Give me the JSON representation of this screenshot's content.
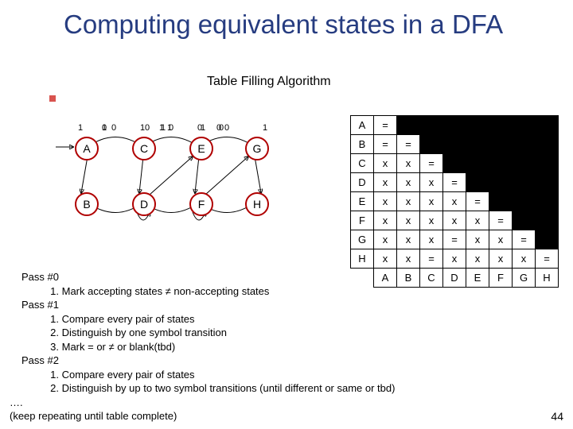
{
  "title": "Computing equivalent states in a DFA",
  "subtitle": "Table Filling Algorithm",
  "nodes": {
    "A": "A",
    "B": "B",
    "C": "C",
    "D": "D",
    "E": "E",
    "F": "F",
    "G": "G",
    "H": "H"
  },
  "edge_labels": {
    "AC0": "0",
    "AC1": "1",
    "AB0": "0",
    "AB1": "1",
    "CE1": "1",
    "CD0": "0",
    "BD1": "1",
    "DF1": "1",
    "DE0": "0",
    "EG0": "0",
    "EF1": "1",
    "FG0": "0",
    "GH1": "1",
    "FH0": "0",
    "D1": "1",
    "F0": "0"
  },
  "table": {
    "rows": [
      "A",
      "B",
      "C",
      "D",
      "E",
      "F",
      "G",
      "H"
    ],
    "cols": [
      "A",
      "B",
      "C",
      "D",
      "E",
      "F",
      "G",
      "H"
    ],
    "cells": [
      [
        "="
      ],
      [
        "=",
        "="
      ],
      [
        "x",
        "x",
        "="
      ],
      [
        "x",
        "x",
        "x",
        "="
      ],
      [
        "x",
        "x",
        "x",
        "x",
        "="
      ],
      [
        "x",
        "x",
        "x",
        "x",
        "x",
        "="
      ],
      [
        "x",
        "x",
        "x",
        "=",
        "x",
        "x",
        "="
      ],
      [
        "x",
        "x",
        "=",
        "x",
        "x",
        "x",
        "x",
        "="
      ]
    ]
  },
  "passes": {
    "p0": "Pass #0",
    "p0_1": "1.",
    "p0_1t": "Mark  accepting states ≠ non-accepting states",
    "p1": "Pass #1",
    "p1_1": "1.",
    "p1_1t": "Compare every pair of states",
    "p1_2": "2.",
    "p1_2t": "Distinguish by one symbol transition",
    "p1_3": "3.",
    "p1_3t": "Mark = or ≠ or blank(tbd)",
    "p2": "Pass #2",
    "p2_1": "1.",
    "p2_1t": "Compare every pair of states",
    "p2_2": "2.",
    "p2_2t": "Distinguish by up to two symbol transitions (until different or same or tbd)",
    "dots": "….",
    "keep": "(keep repeating until table complete)"
  },
  "pagenum": "44"
}
